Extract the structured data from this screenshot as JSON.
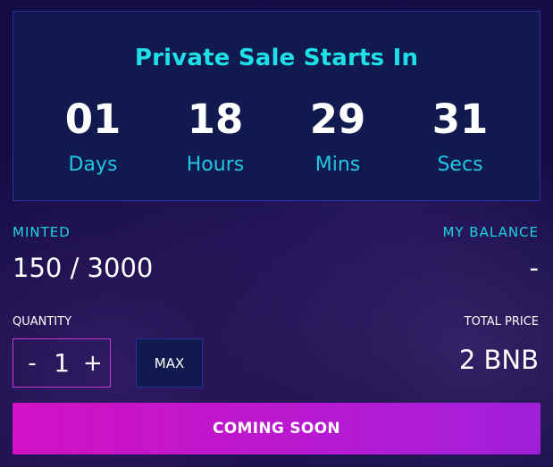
{
  "countdown": {
    "title": "Private Sale Starts In",
    "units": [
      {
        "value": "01",
        "label": "Days"
      },
      {
        "value": "18",
        "label": "Hours"
      },
      {
        "value": "29",
        "label": "Mins"
      },
      {
        "value": "31",
        "label": "Secs"
      }
    ]
  },
  "stats": {
    "minted_label": "MINTED",
    "minted_value": "150 / 3000",
    "balance_label": "MY BALANCE",
    "balance_value": "-"
  },
  "purchase": {
    "quantity_label": "QUANTITY",
    "decrement_symbol": "-",
    "quantity_value": "1",
    "increment_symbol": "+",
    "max_label": "MAX",
    "total_label": "TOTAL PRICE",
    "total_value": "2 BNB",
    "action_label": "COMING SOON"
  },
  "colors": {
    "accent_cyan": "#1ee0e8",
    "button_gradient_start": "#d111c3",
    "button_gradient_end": "#9f1fdb",
    "panel_background": "#111a4f",
    "page_background": "#140c45"
  }
}
